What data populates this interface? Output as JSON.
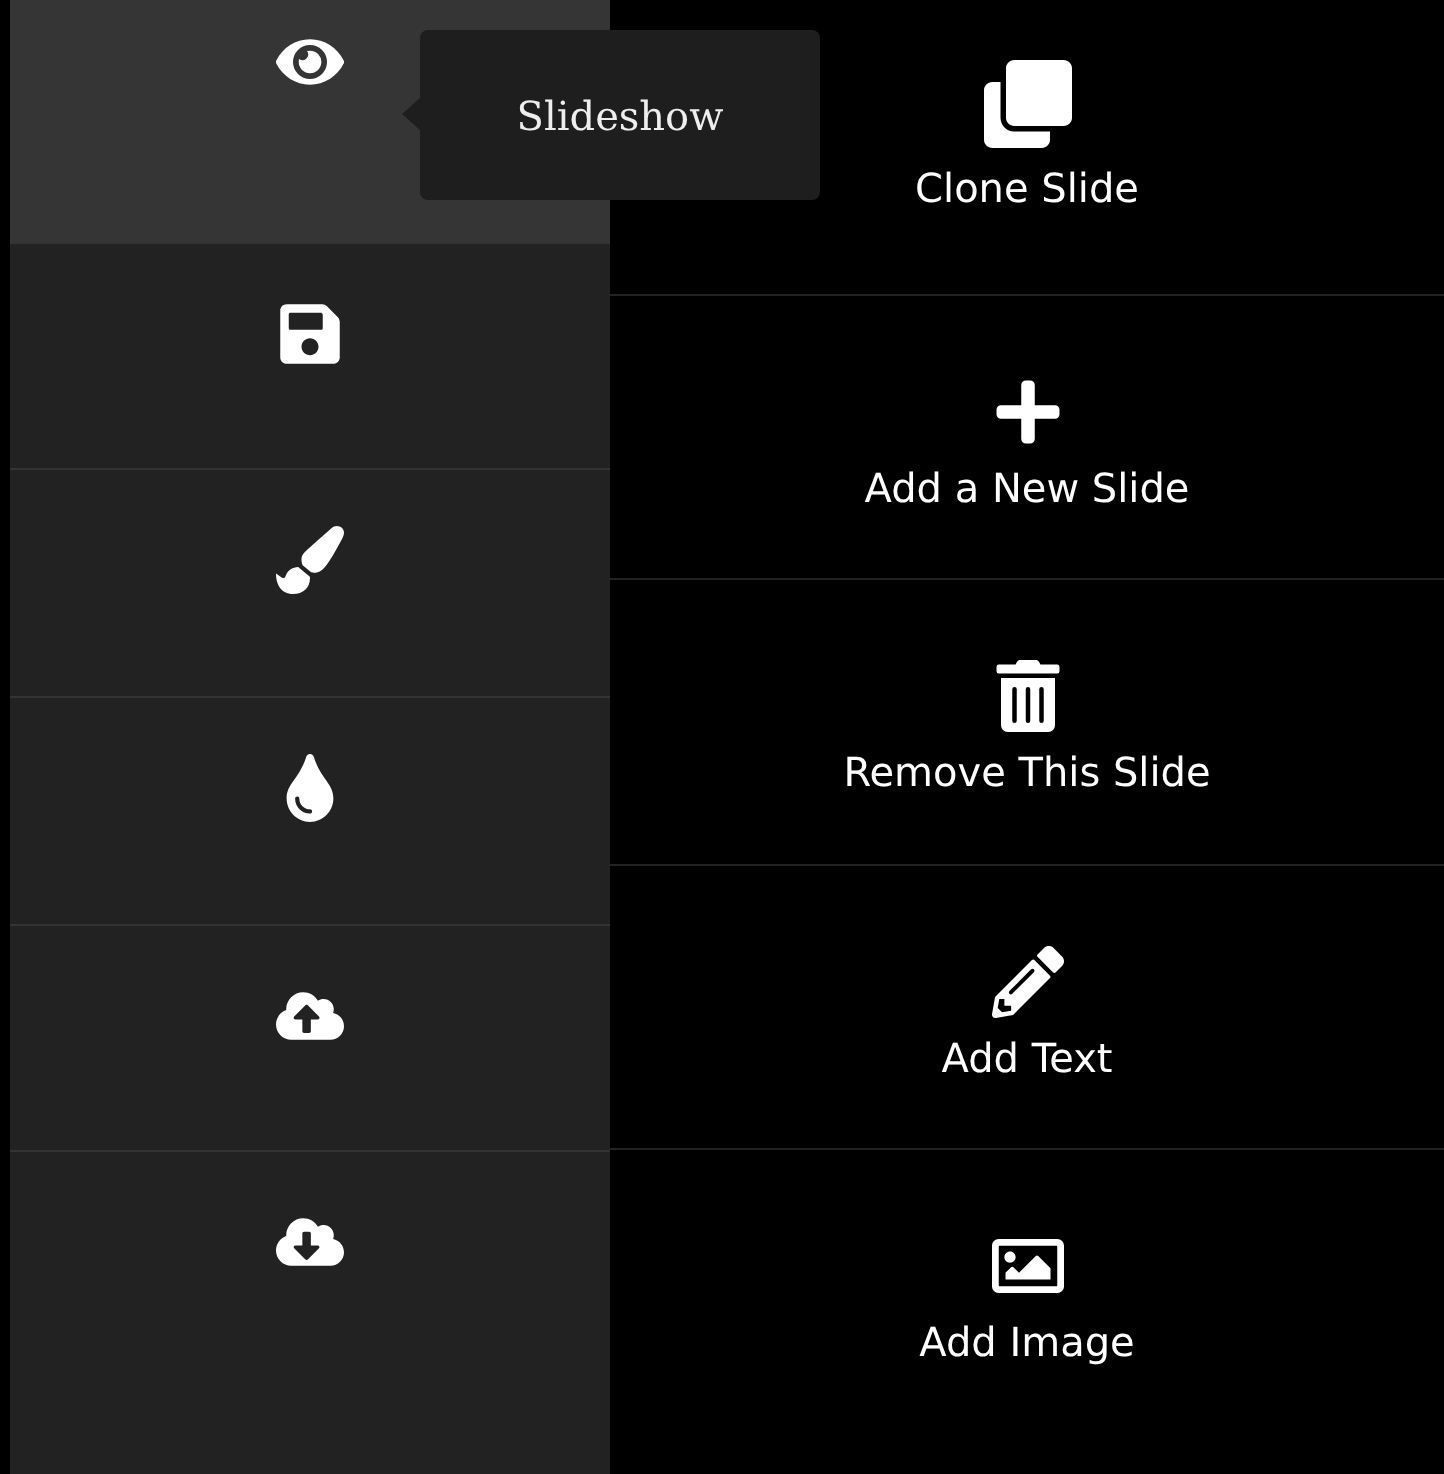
{
  "sidebar": {
    "items": [
      {
        "selected": true
      },
      {
        "selected": false
      },
      {
        "selected": false
      },
      {
        "selected": false
      },
      {
        "selected": false
      },
      {
        "selected": false
      }
    ]
  },
  "tooltip": {
    "text": "Slideshow"
  },
  "actions": [
    {
      "label": "Clone Slide"
    },
    {
      "label": "Add a New Slide"
    },
    {
      "label": "Remove This Slide"
    },
    {
      "label": "Add Text"
    },
    {
      "label": "Add Image"
    }
  ]
}
